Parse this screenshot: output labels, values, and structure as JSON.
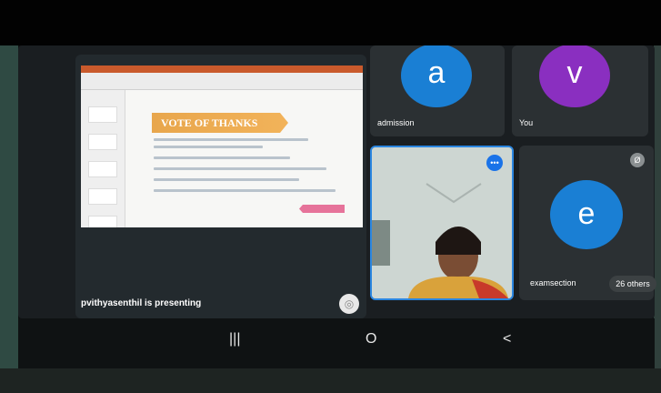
{
  "presentation": {
    "slide_title": "VOTE OF THANKS",
    "presenting_label": "pvithyasenthil is presenting"
  },
  "participants": [
    {
      "initial": "a",
      "name": "admission",
      "color": "#1a7fd4"
    },
    {
      "initial": "v",
      "name": "You",
      "color": "#8a2fc0"
    },
    {
      "initial": "e",
      "name": "examsection",
      "color": "#1a7fd4"
    }
  ],
  "others_count": "26 others",
  "nav": {
    "recents": "|||",
    "home": "O",
    "back": "<"
  }
}
